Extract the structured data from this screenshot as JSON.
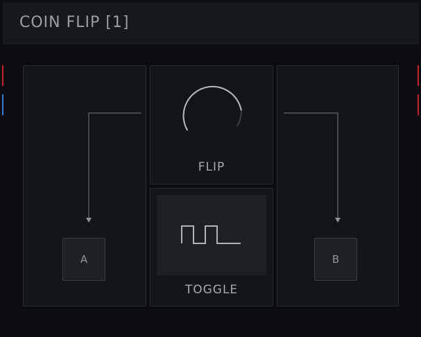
{
  "header": {
    "title": "COIN FLIP [1]"
  },
  "ports": {
    "left": [
      {
        "color": "#c4222e"
      },
      {
        "color": "#3a7fd4"
      }
    ],
    "right": [
      {
        "color": "#c4222e"
      },
      {
        "color": "#c4222e"
      }
    ]
  },
  "flip": {
    "label": "FLIP",
    "knob_icon": "knob-arc-icon"
  },
  "toggle": {
    "label": "TOGGLE",
    "wave_icon": "square-wave-icon"
  },
  "outputs": {
    "a_label": "A",
    "b_label": "B"
  },
  "colors": {
    "background": "#0b0d10",
    "panel": "#121519",
    "accent_red": "#c4222e",
    "accent_blue": "#3a7fd4"
  }
}
